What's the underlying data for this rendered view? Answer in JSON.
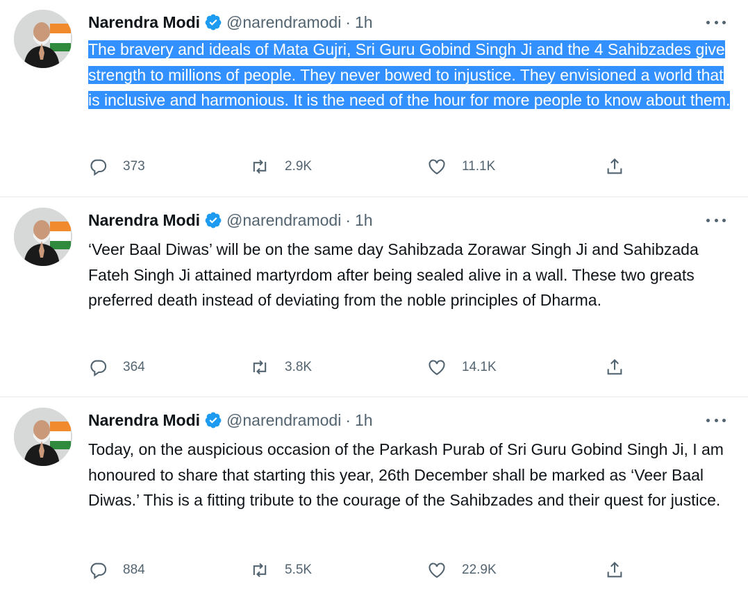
{
  "tweets": [
    {
      "author_name": "Narendra Modi",
      "handle": "@narendramodi",
      "separator": "·",
      "time": "1h",
      "text": "The bravery and ideals of Mata Gujri, Sri Guru Gobind Singh Ji and the 4 Sahibzades give strength to millions of people. They never bowed to injustice. They envisioned a world that is inclusive and harmonious. It is the need of the hour for more people to know about them.",
      "text_selected": true,
      "replies": "373",
      "retweets": "2.9K",
      "likes": "11.1K"
    },
    {
      "author_name": "Narendra Modi",
      "handle": "@narendramodi",
      "separator": "·",
      "time": "1h",
      "text": "‘Veer Baal Diwas’ will be on the same day Sahibzada Zorawar Singh Ji and Sahibzada Fateh Singh Ji attained martyrdom after being sealed alive in a wall. These two greats preferred death instead of deviating from the noble principles of Dharma.",
      "text_selected": false,
      "replies": "364",
      "retweets": "3.8K",
      "likes": "14.1K"
    },
    {
      "author_name": "Narendra Modi",
      "handle": "@narendramodi",
      "separator": "·",
      "time": "1h",
      "text": "Today, on the auspicious occasion of the Parkash Purab of Sri Guru Gobind Singh Ji, I am honoured to share that starting this year, 26th December shall be marked as ‘Veer Baal Diwas.’ This is a fitting tribute to the courage of the Sahibzades and their quest for justice.",
      "text_selected": false,
      "replies": "884",
      "retweets": "5.5K",
      "likes": "22.9K"
    }
  ],
  "icons": {
    "verified": "verified-badge-icon",
    "more": "more-options-icon",
    "reply": "reply-icon",
    "retweet": "retweet-icon",
    "like": "like-icon",
    "share": "share-icon"
  },
  "colors": {
    "accent": "#1d9bf0",
    "selection": "#3390ff",
    "secondary_text": "#536471",
    "divider": "#e6ecf0"
  }
}
